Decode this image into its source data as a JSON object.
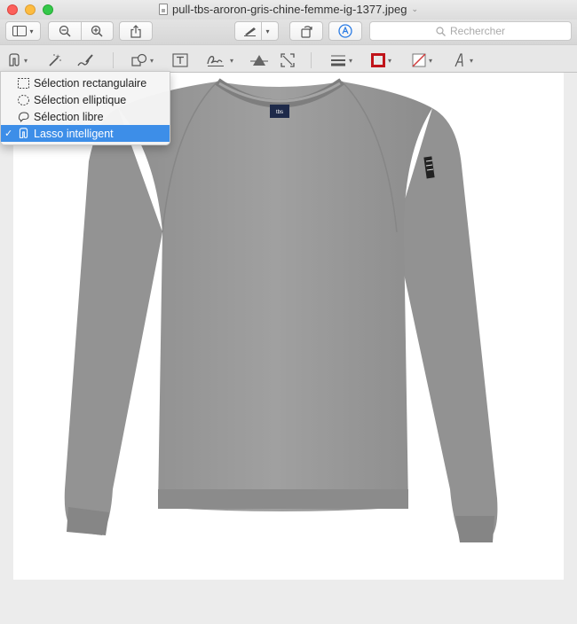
{
  "window": {
    "title": "pull-tbs-aroron-gris-chine-femme-ig-1377.jpeg"
  },
  "toolbar": {
    "search_placeholder": "Rechercher"
  },
  "selection_menu": {
    "items": [
      {
        "label": "Sélection rectangulaire",
        "icon": "rect-selection-icon",
        "checked": false
      },
      {
        "label": "Sélection elliptique",
        "icon": "ellipse-selection-icon",
        "checked": false
      },
      {
        "label": "Sélection libre",
        "icon": "freehand-selection-icon",
        "checked": false
      },
      {
        "label": "Lasso intelligent",
        "icon": "smart-lasso-icon",
        "checked": true
      }
    ],
    "check_mark": "✓"
  },
  "image": {
    "label_text": "tbs",
    "sweater_color": "#9a9a9a"
  },
  "colors": {
    "accent": "#3d8ee8",
    "border_color_swatch": "#c0141a",
    "fill_swatch": "#d13b3b"
  }
}
